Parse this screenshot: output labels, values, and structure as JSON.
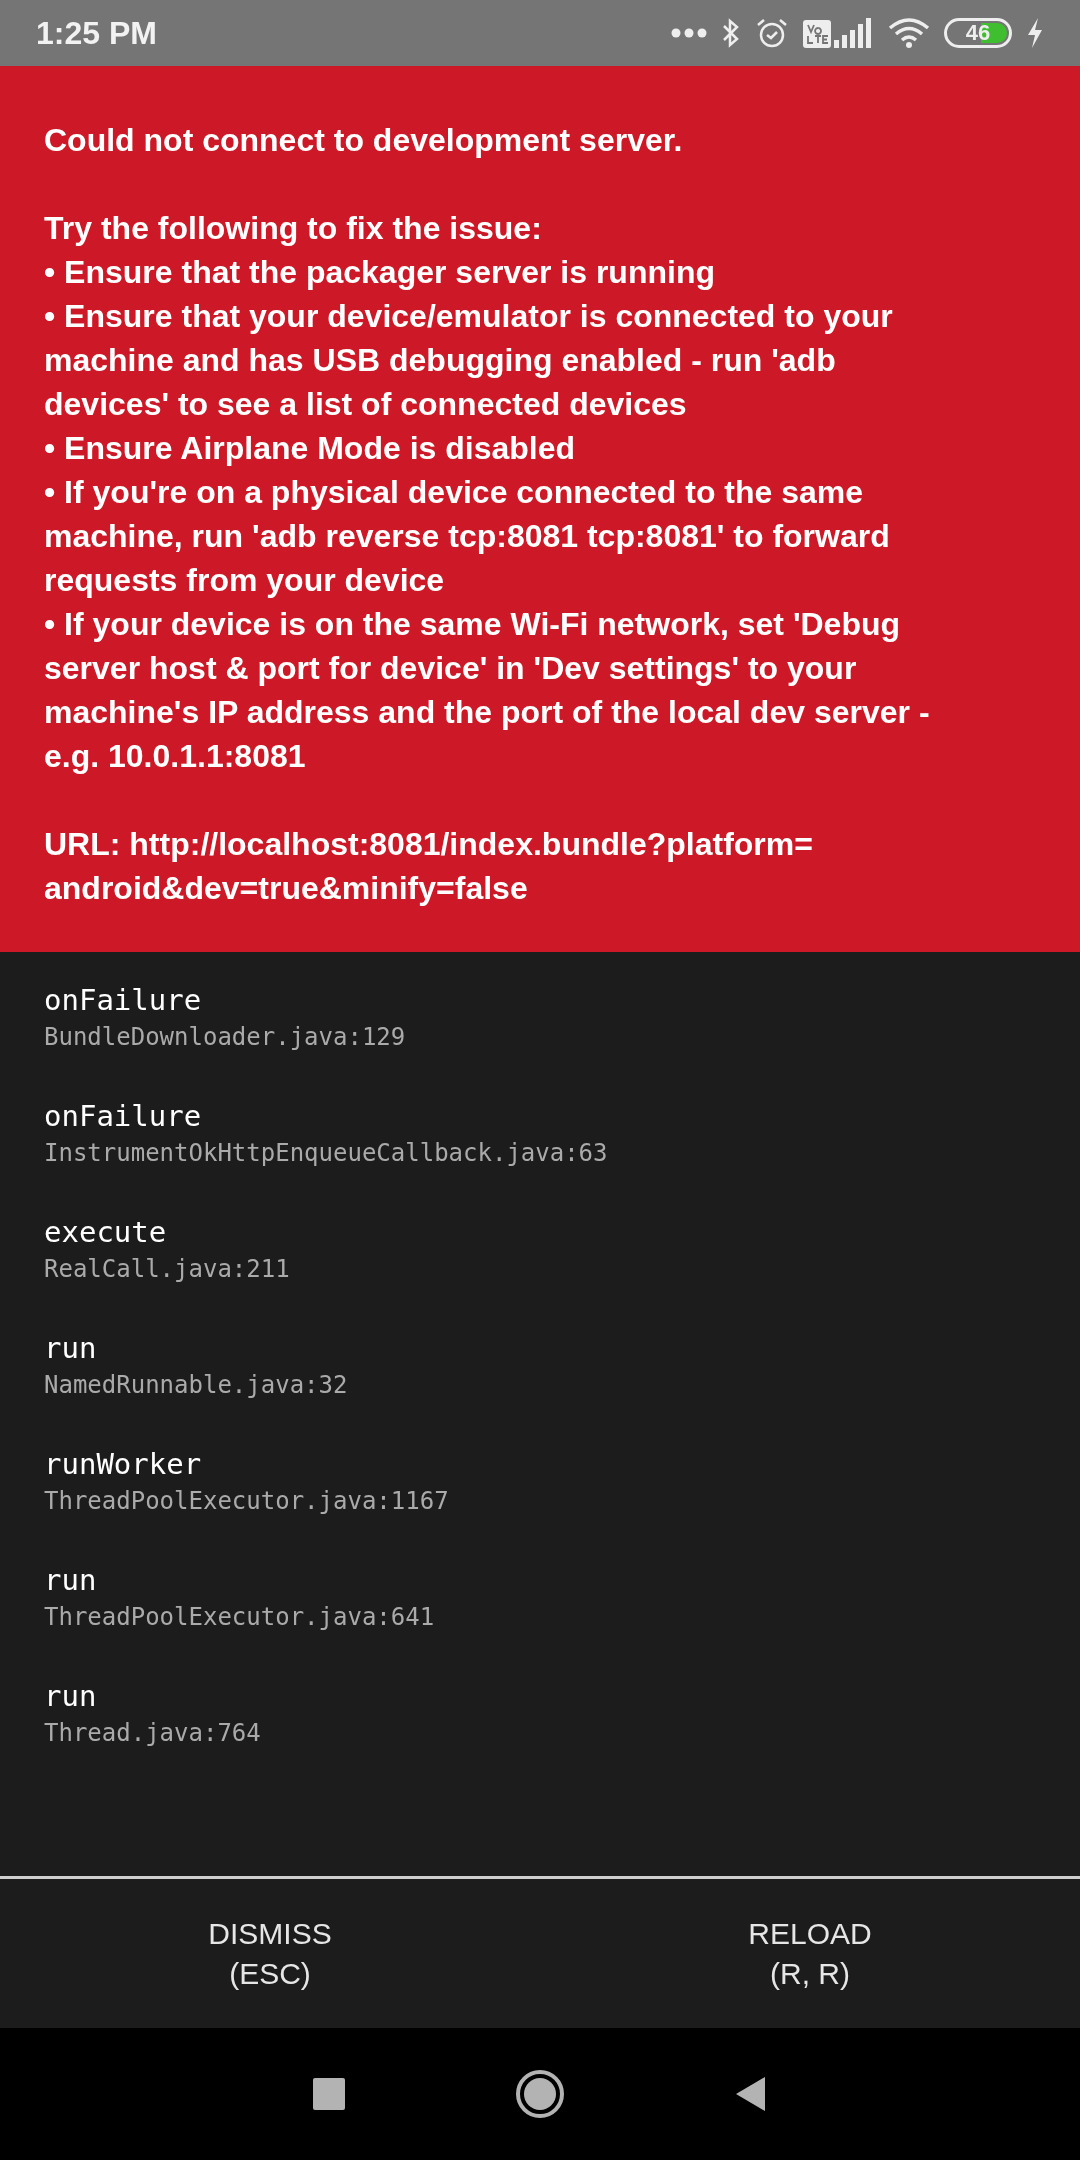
{
  "status_bar": {
    "time": "1:25 PM",
    "battery": "46"
  },
  "error": {
    "paragraphs": [
      {
        "lines": [
          "Could not connect to development server."
        ]
      },
      {
        "lines": [
          "Try the following to fix the issue:",
          "• Ensure that the packager server is running",
          "• Ensure that your device/emulator is connected to your",
          "machine and has USB debugging enabled - run 'adb",
          "devices' to see a list of connected devices",
          "• Ensure Airplane Mode is disabled",
          "• If you're on a physical device connected to the same",
          "machine, run 'adb reverse tcp:8081 tcp:8081' to forward",
          "requests from your device",
          "• If your device is on the same Wi-Fi network, set 'Debug",
          "server host & port for device' in 'Dev settings' to your",
          "machine's IP address and the port of the local dev server -",
          "e.g. 10.0.1.1:8081"
        ]
      },
      {
        "lines": [
          "URL: http://localhost:8081/index.bundle?platform=",
          "android&dev=true&minify=false"
        ]
      }
    ]
  },
  "stack": [
    {
      "method": "onFailure",
      "file": "BundleDownloader.java:129"
    },
    {
      "method": "onFailure",
      "file": "InstrumentOkHttpEnqueueCallback.java:63"
    },
    {
      "method": "execute",
      "file": "RealCall.java:211"
    },
    {
      "method": "run",
      "file": "NamedRunnable.java:32"
    },
    {
      "method": "runWorker",
      "file": "ThreadPoolExecutor.java:1167"
    },
    {
      "method": "run",
      "file": "ThreadPoolExecutor.java:641"
    },
    {
      "method": "run",
      "file": "Thread.java:764"
    }
  ],
  "buttons": [
    {
      "lines": [
        "DISMISS",
        "(ESC)"
      ]
    },
    {
      "lines": [
        "RELOAD",
        "(R, R)"
      ]
    }
  ]
}
